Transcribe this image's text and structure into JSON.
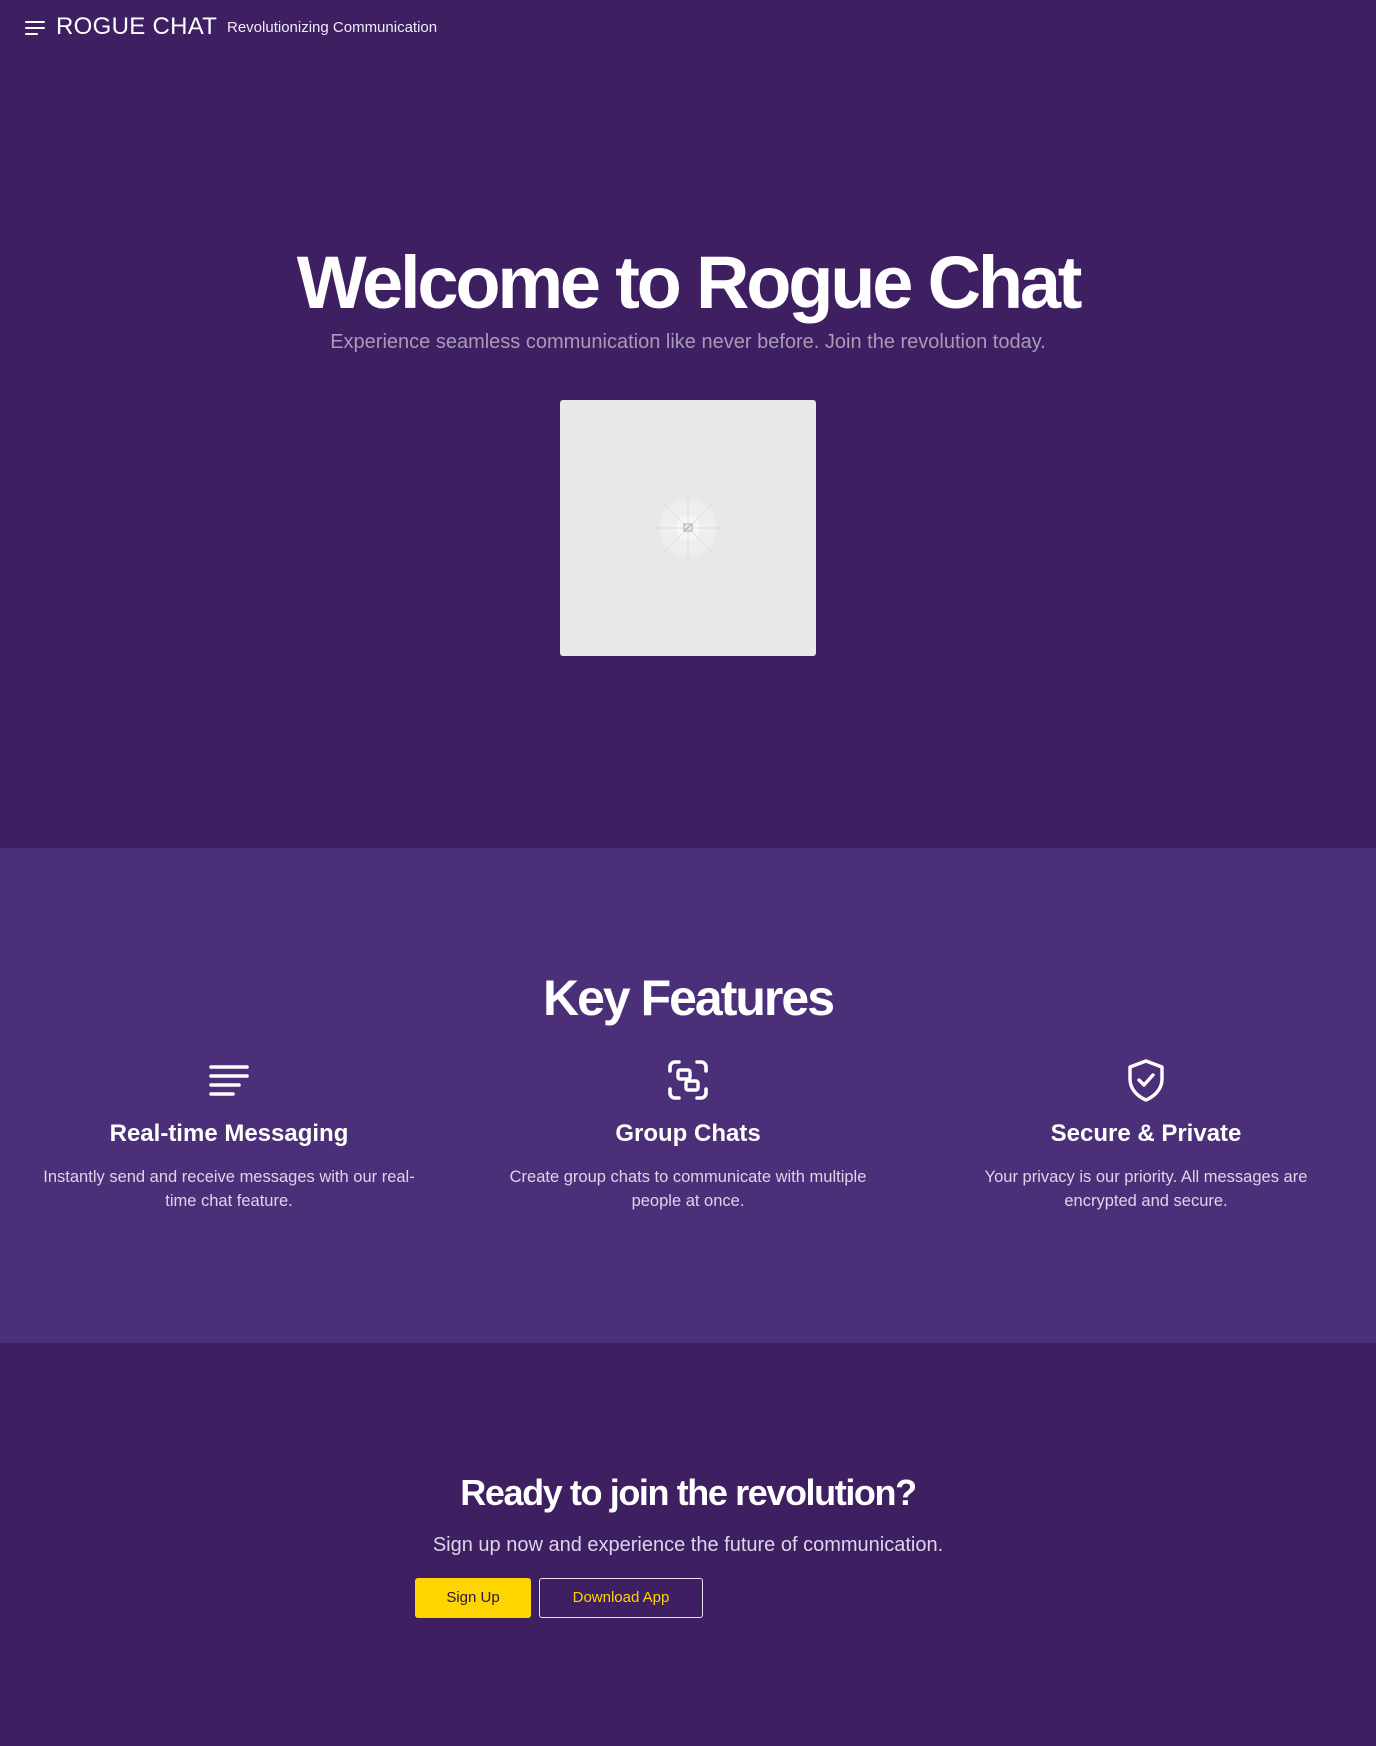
{
  "colors": {
    "background": "#3d1f62",
    "features_background": "#4b2f78",
    "accent": "#ffd500",
    "text": "#ffffff",
    "muted_text": "#a89bb9",
    "placeholder_image": "#e8e8e8"
  },
  "header": {
    "menu_icon": "hamburger-menu-icon",
    "brand": "ROGUE CHAT",
    "tagline": "Revolutionizing Communication"
  },
  "hero": {
    "title": "Welcome to Rogue Chat",
    "subtitle": "Experience seamless communication like never before. Join the revolution today.",
    "image_icon": "broken-image-icon"
  },
  "features": {
    "title": "Key Features",
    "items": [
      {
        "icon": "lines-icon",
        "title": "Real-time Messaging",
        "description": "Instantly send and receive messages with our real-time chat feature."
      },
      {
        "icon": "group-frame-icon",
        "title": "Group Chats",
        "description": "Create group chats to communicate with multiple people at once."
      },
      {
        "icon": "shield-check-icon",
        "title": "Secure & Private",
        "description": "Your privacy is our priority. All messages are encrypted and secure."
      }
    ]
  },
  "cta": {
    "title": "Ready to join the revolution?",
    "subtitle": "Sign up now and experience the future of communication.",
    "signup_label": "Sign Up",
    "download_label": "Download App"
  }
}
